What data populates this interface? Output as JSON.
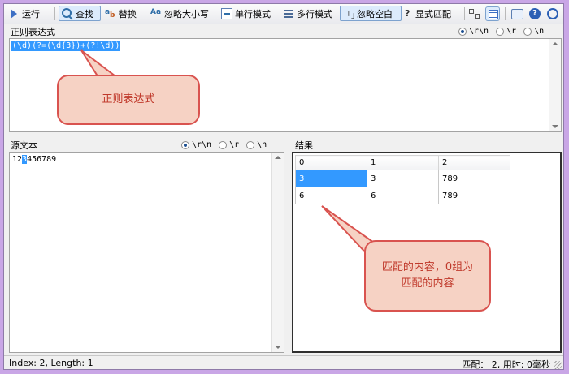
{
  "toolbar": {
    "run": "运行",
    "find": "查找",
    "replace": "替换",
    "ignore_case": "忽略大小写",
    "single_line": "单行模式",
    "multi_line": "多行模式",
    "ignore_whitespace": "忽略空白",
    "explicit_capture": "显式匹配",
    "ignore_whitespace_icon_text": "「」",
    "explicit_capture_icon_text": "?",
    "ignore_case_icon_text": "Aa"
  },
  "newline_options": [
    "\\r\\n",
    "\\r",
    "\\n"
  ],
  "regex_panel": {
    "title": "正则表达式",
    "selected_newline": "\\r\\n",
    "expression": "(\\d)(?=(\\d{3})+(?!\\d))"
  },
  "source_panel": {
    "title": "源文本",
    "selected_newline": "\\r\\n",
    "text_before": "12",
    "text_highlight": "3",
    "text_after": "456789"
  },
  "result_panel": {
    "title": "结果",
    "columns": [
      "0",
      "1",
      "2"
    ],
    "rows": [
      [
        "3",
        "3",
        "789"
      ],
      [
        "6",
        "6",
        "789"
      ]
    ]
  },
  "callouts": {
    "regex": "正则表达式",
    "result": "匹配的内容，0组为匹配的内容"
  },
  "status": {
    "left": "Index: 2, Length: 1",
    "right": "匹配： 2, 用时: 0毫秒"
  },
  "colors": {
    "selection": "#3399ff",
    "callout_border": "#d9534f",
    "callout_fill": "#f6d2c4",
    "frame": "#c9a6e6"
  },
  "icons": [
    "run-icon",
    "find-icon",
    "replace-icon",
    "ignore-case-icon",
    "single-line-icon",
    "multi-line-icon",
    "ignore-whitespace-icon",
    "explicit-capture-icon",
    "layout-split-icon",
    "layout-grid-icon",
    "options-icon",
    "help-icon",
    "about-icon"
  ]
}
